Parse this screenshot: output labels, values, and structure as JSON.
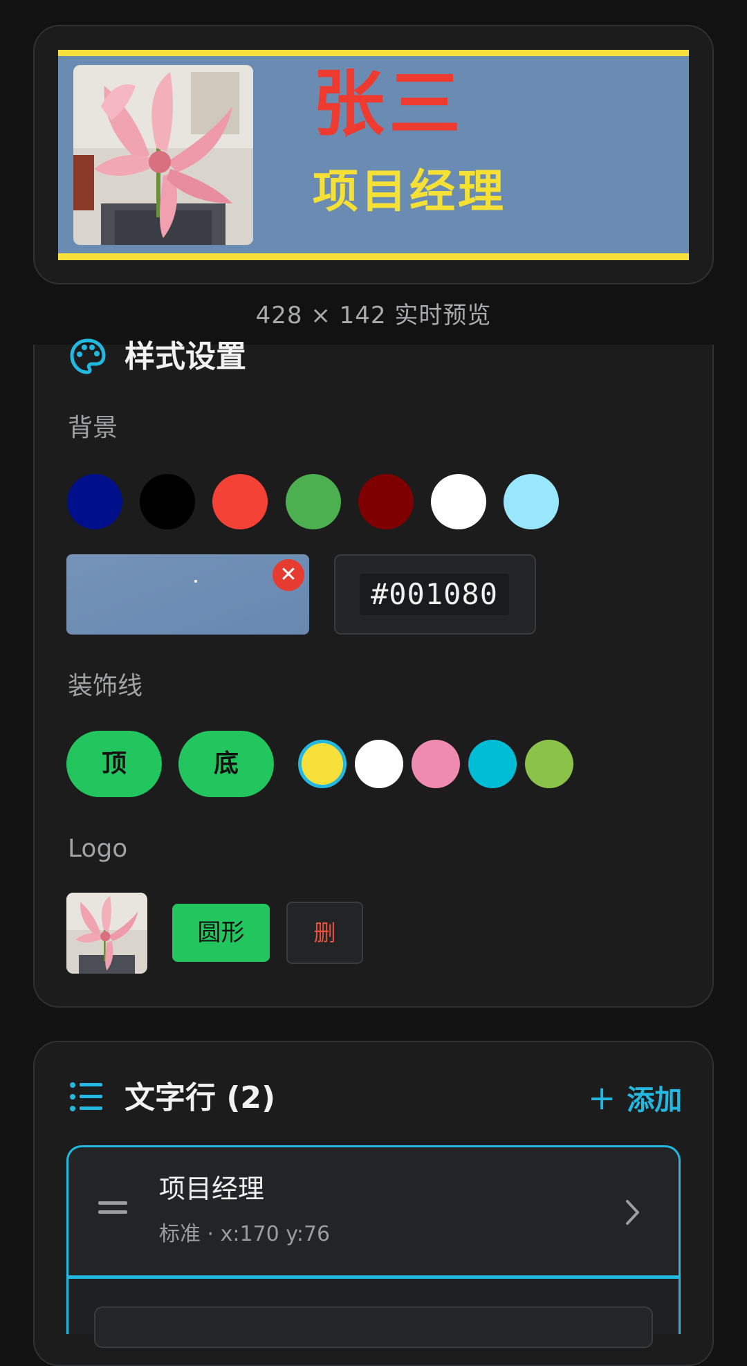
{
  "preview": {
    "name": "张三",
    "title": "项目经理",
    "caption": "428 × 142 实时预览",
    "name_color": "#ef3b2f",
    "title_color": "#f5e135",
    "background_color": "#6a8bb2",
    "decoration_color": "#f7e03a"
  },
  "style_section": {
    "icon": "palette-icon",
    "title": "样式设置",
    "background_label": "背景",
    "background_swatches": [
      "#00108a",
      "#000000",
      "#f44336",
      "#4caf50",
      "#7f0000",
      "#ffffff",
      "#99e7fc"
    ],
    "background_image_remove_icon": "close-icon",
    "hex_value": "#001080",
    "decoration_label": "装饰线",
    "decoration_top_label": "顶",
    "decoration_bottom_label": "底",
    "decoration_swatches": [
      "#f7e03a",
      "#ffffff",
      "#f08bb0",
      "#00bcd4",
      "#8bc34a"
    ],
    "decoration_selected": "#f7e03a",
    "logo_label": "Logo",
    "logo_shape_label": "圆形",
    "logo_delete_label": "删"
  },
  "rows_section": {
    "icon": "list-icon",
    "title": "文字行 (2)",
    "add_label": "添加",
    "add_icon": "plus-icon",
    "rows": [
      {
        "name": "项目经理",
        "meta": "标准 · x:170 y:76",
        "handle_icon": "drag-handle-icon",
        "chevron_icon": "chevron-right-icon"
      }
    ],
    "accent_color": "#22b8e0"
  }
}
